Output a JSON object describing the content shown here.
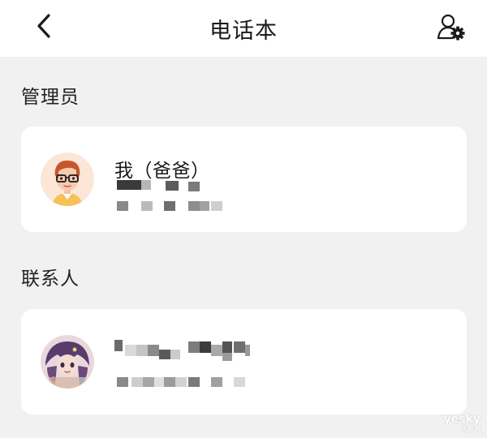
{
  "header": {
    "title": "电话本",
    "back_icon": "chevron-left-icon",
    "settings_icon": "contact-settings-icon"
  },
  "sections": {
    "admin_label": "管理员",
    "contacts_label": "联系人"
  },
  "admin": {
    "name": "我（爸爸）",
    "phone": "",
    "avatar_icon": "cartoon-man-avatar"
  },
  "contact": {
    "name": "",
    "phone": "",
    "avatar_icon": "anime-girl-avatar"
  },
  "watermark": {
    "brand": "yesky",
    "sub": "天极网"
  },
  "colors": {
    "background": "#f1f1f1",
    "card": "#ffffff",
    "text": "#1a1a1a"
  }
}
